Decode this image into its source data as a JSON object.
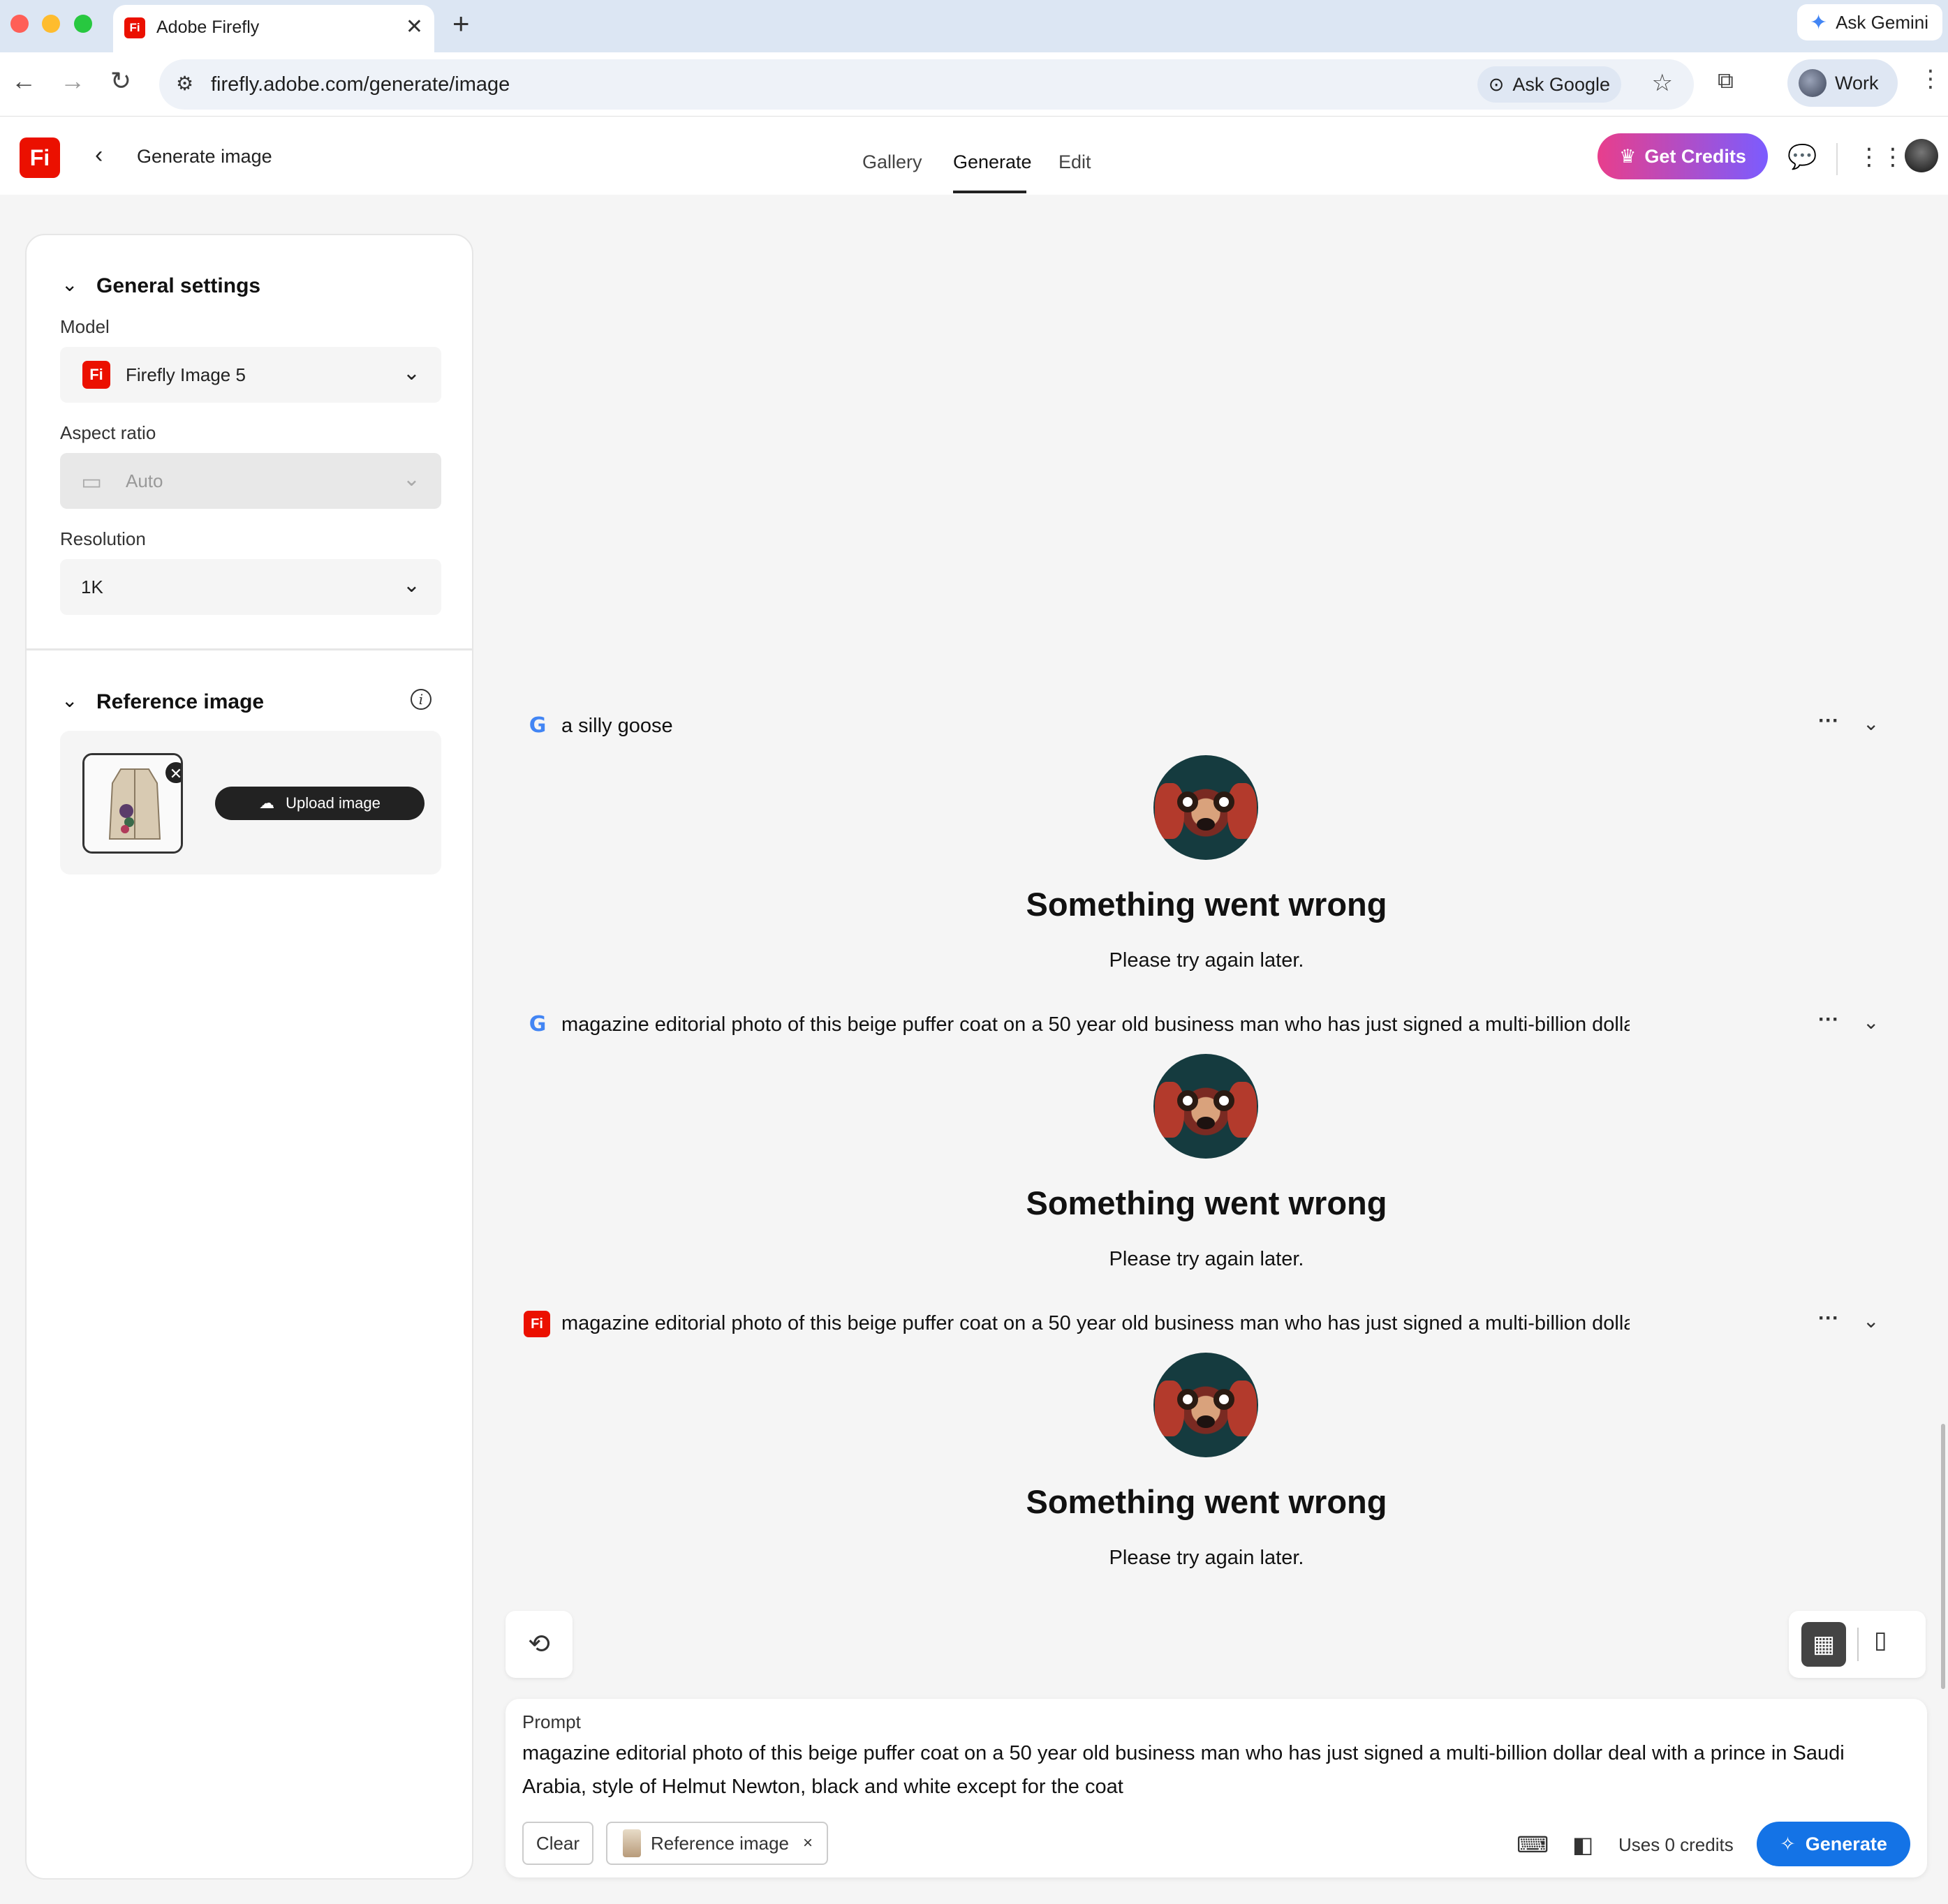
{
  "browser": {
    "tab_title": "Adobe Firefly",
    "tab_favicon": "Fi",
    "new_tab": "+",
    "tab_close": "✕",
    "ask_gemini": "Ask Gemini",
    "url": "firefly.adobe.com/generate/image",
    "ask_google": "Ask Google",
    "profile": "Work"
  },
  "app": {
    "logo": "Fi",
    "title": "Generate image",
    "nav_tabs": [
      {
        "label": "Gallery"
      },
      {
        "label": "Generate"
      },
      {
        "label": "Edit"
      }
    ],
    "get_credits": "Get Credits",
    "active_tab": "Generate"
  },
  "settings": {
    "general_heading": "General settings",
    "model_label": "Model",
    "model_value": "Firefly Image 5",
    "model_icon": "Fi",
    "aspect_label": "Aspect ratio",
    "aspect_value": "Auto",
    "resolution_label": "Resolution",
    "resolution_value": "1K",
    "reference_heading": "Reference image",
    "upload_label": "Upload image"
  },
  "results": [
    {
      "source": "google",
      "badge": "G",
      "prompt": "a silly goose",
      "error_title": "Something went wrong",
      "error_sub": "Please try again later."
    },
    {
      "source": "google",
      "badge": "G",
      "prompt": "magazine editorial photo of this beige puffer coat on a 50 year old business man who has just signed a multi-billion dollar deal with a prin",
      "error_title": "Something went wrong",
      "error_sub": "Please try again later."
    },
    {
      "source": "firefly",
      "badge": "Fi",
      "prompt": "magazine editorial photo of this beige puffer coat on a 50 year old business man who has just signed a multi-billion dollar deal with a prin",
      "error_title": "Something went wrong",
      "error_sub": "Please try again later."
    }
  ],
  "prompt_panel": {
    "label": "Prompt",
    "text": "magazine editorial photo of this beige puffer coat on a 50 year old business man who has just signed a multi-billion dollar deal with a prince in Saudi Arabia, style of Helmut Newton, black and white except for the coat",
    "clear": "Clear",
    "reference_chip": "Reference image",
    "chip_close": "×",
    "uses_credits": "Uses 0 credits",
    "generate": "Generate"
  },
  "colors": {
    "brand_red": "#eb1000",
    "generate_blue": "#1473e6",
    "credits_gradient_start": "#e83e8c",
    "credits_gradient_end": "#7b5cff"
  }
}
